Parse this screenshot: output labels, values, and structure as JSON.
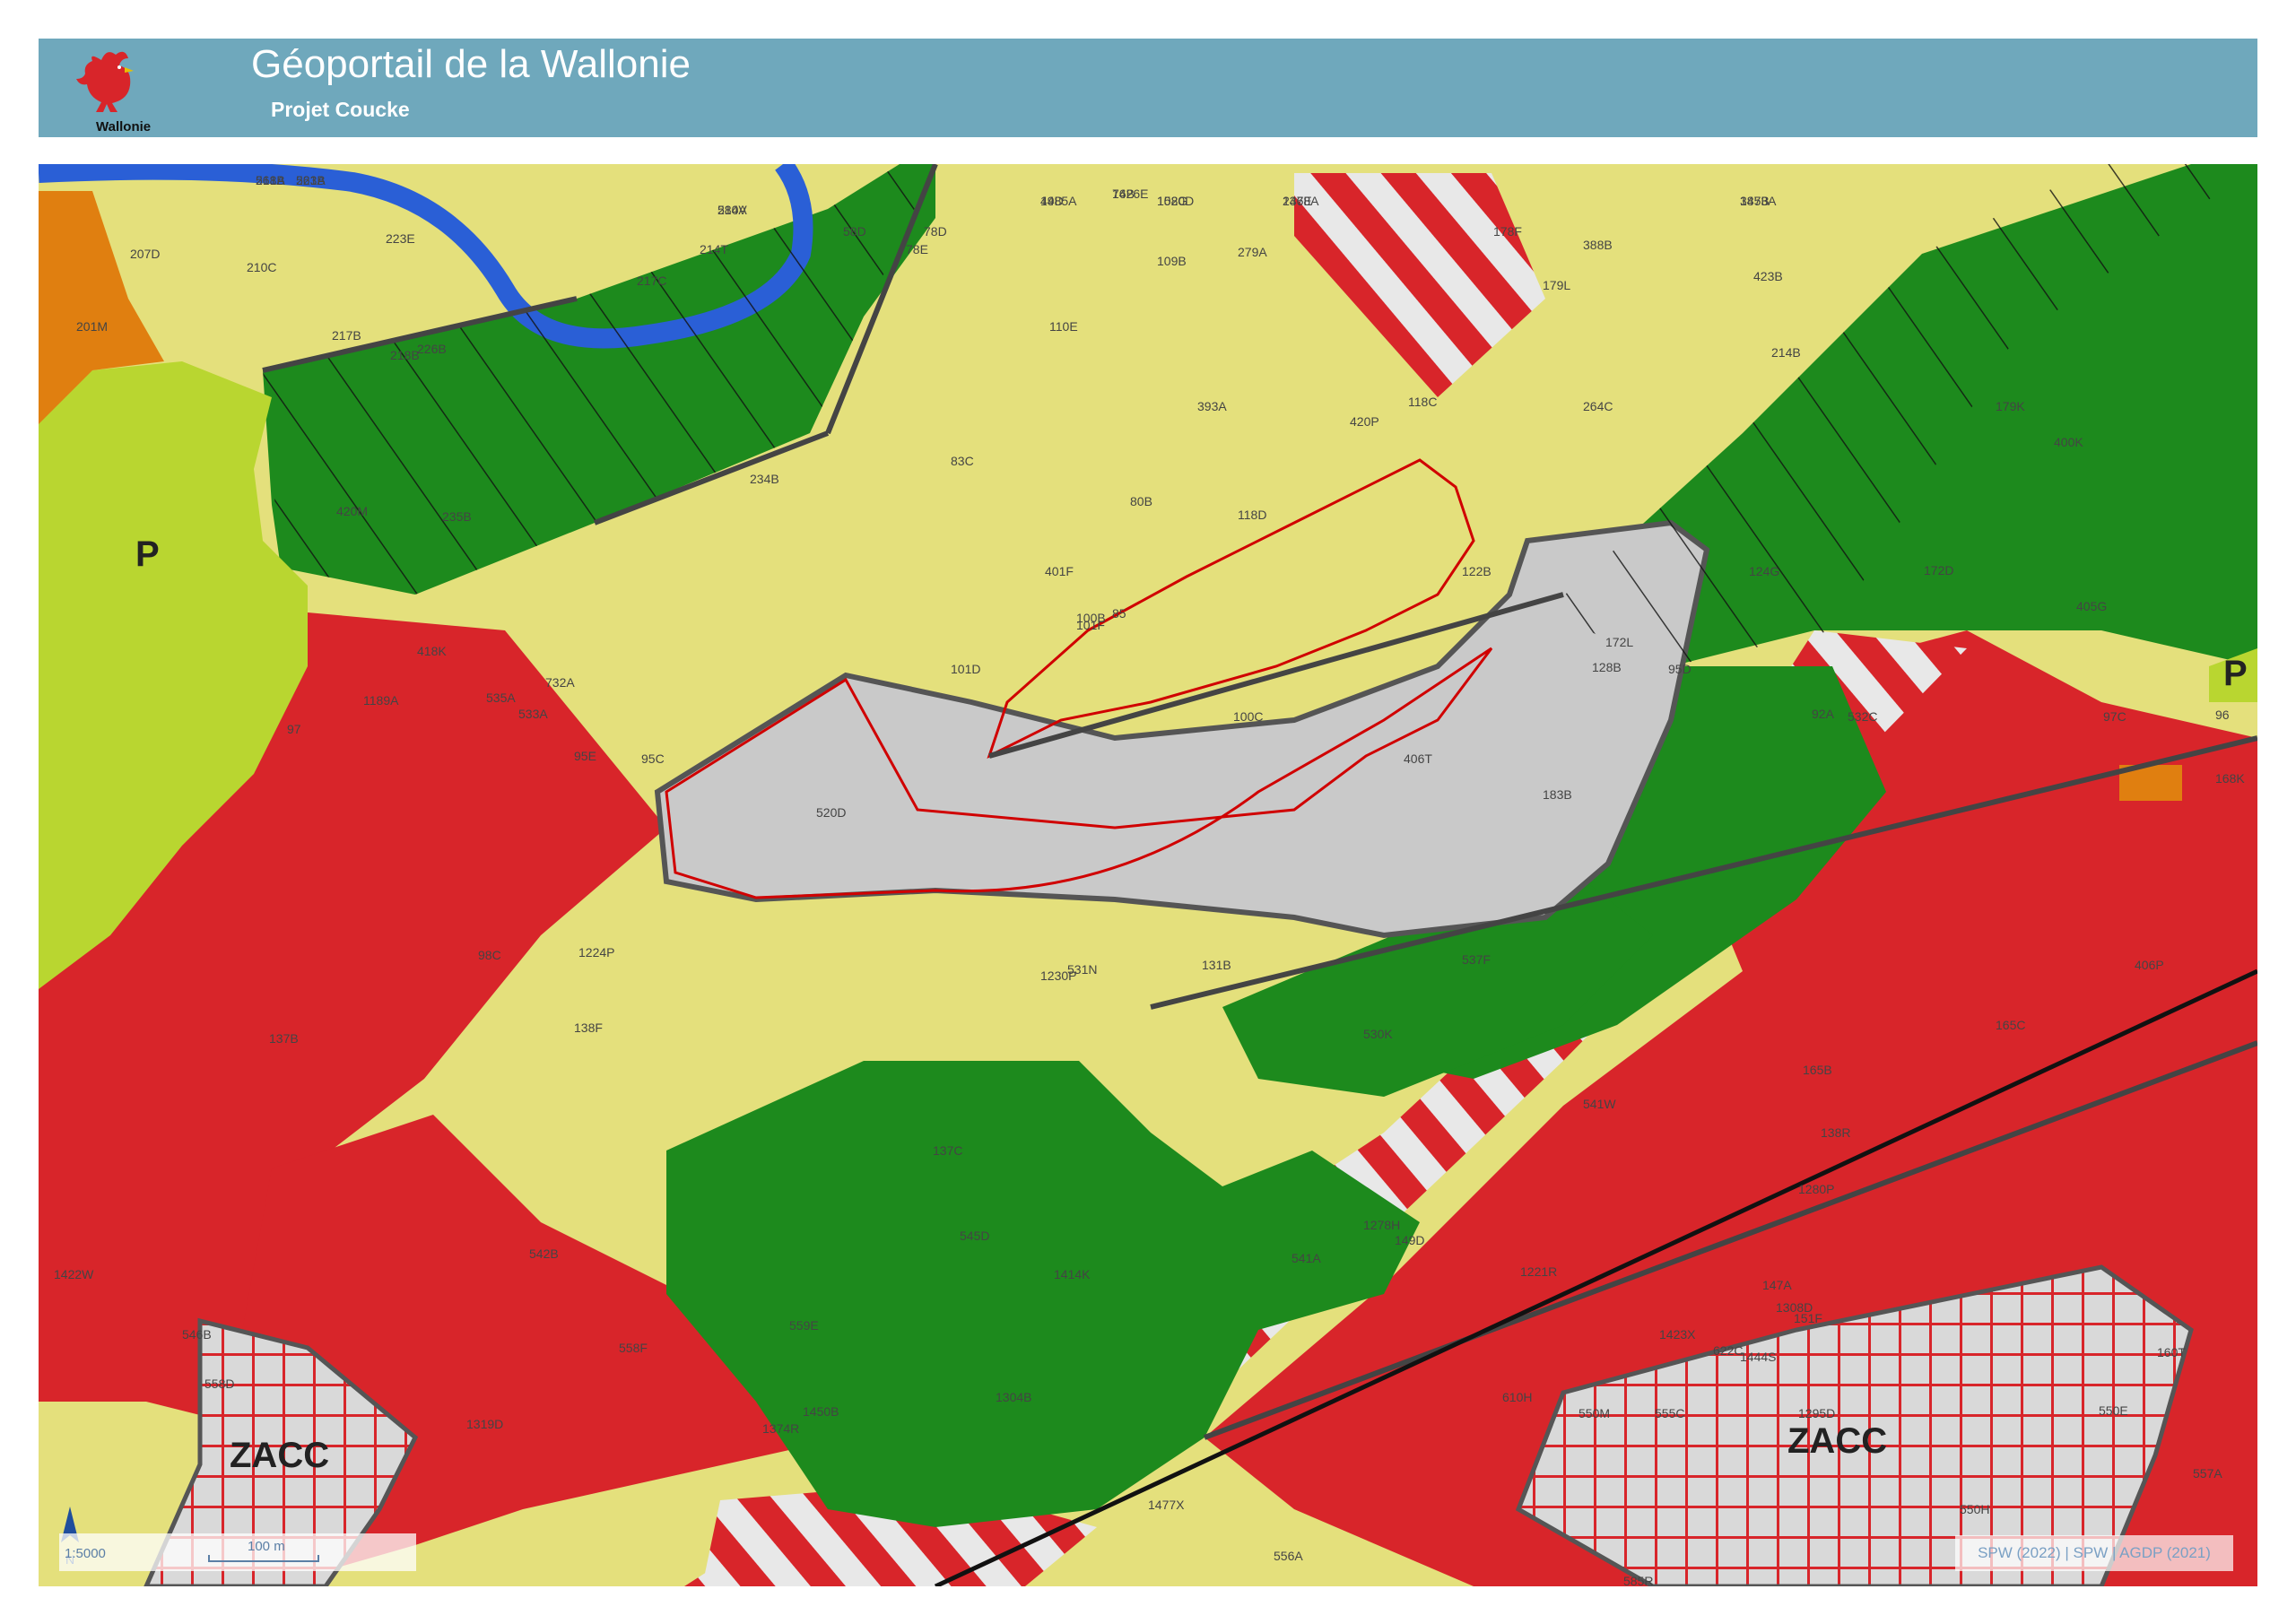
{
  "header": {
    "title": "Géoportail de la Wallonie",
    "subtitle": "Projet Coucke",
    "logo_text": "Wallonie",
    "logo_icon": "rooster-icon",
    "background_color": "#6fa8bc"
  },
  "map": {
    "zone_colors": {
      "habitat": "#d8252a",
      "agricultural": "#e4e07c",
      "forest": "#1d8a1d",
      "green_space": "#b9d630",
      "zacc": "#d9d9d9",
      "public_equipment": "#e07f10",
      "water": "#2a5fd6"
    },
    "zone_labels": [
      "P",
      "P",
      "ZACC",
      "ZACC"
    ],
    "parcel_labels": [
      "218B",
      "221B",
      "214V",
      "76B",
      "49D",
      "108G",
      "236E",
      "385B",
      "207D",
      "210C",
      "223E",
      "217C",
      "214T",
      "58D",
      "78D",
      "78E",
      "109B",
      "279A",
      "178F",
      "388B",
      "201M",
      "217B",
      "218B",
      "226B",
      "110E",
      "179L",
      "423B",
      "393A",
      "420P",
      "118C",
      "264C",
      "214B",
      "179K",
      "400K",
      "420M",
      "235B",
      "234B",
      "83C",
      "80B",
      "118D",
      "122B",
      "124G",
      "401F",
      "85",
      "101F",
      "101D",
      "100B",
      "100C",
      "128B",
      "172L",
      "172D",
      "405G",
      "418K",
      "1189A",
      "535A",
      "732A",
      "533A",
      "95C",
      "95D",
      "92A",
      "96",
      "97",
      "95E",
      "406T",
      "183B",
      "532C",
      "97C",
      "168K",
      "520D",
      "531N",
      "537F",
      "98C",
      "131B",
      "406P",
      "1224P",
      "530K",
      "165C",
      "165B",
      "138R",
      "137B",
      "138F",
      "1230P",
      "541W",
      "137C",
      "1280P",
      "1278H",
      "1414K",
      "545D",
      "541A",
      "149D",
      "147A",
      "151F",
      "1295D",
      "1422W",
      "546B",
      "542B",
      "1304B",
      "1423X",
      "622C",
      "160T",
      "1221R",
      "1308D",
      "1444S",
      "610H",
      "550M",
      "555C",
      "556A",
      "558D",
      "559E",
      "558F",
      "1319D",
      "1374R",
      "1450B",
      "1477X",
      "585R",
      "550H",
      "550E",
      "557A",
      "561A",
      "563A",
      "580A",
      "1426E",
      "1485A",
      "1520D",
      "1478A",
      "1473A"
    ],
    "red_outline_color": "#d00000"
  },
  "scalebar": {
    "ratio": "1:5000",
    "distance": "100 m"
  },
  "north_arrow": {
    "label": "N",
    "icon": "north-arrow-icon"
  },
  "attribution": "SPW (2022) | SPW | AGDP (2021)"
}
